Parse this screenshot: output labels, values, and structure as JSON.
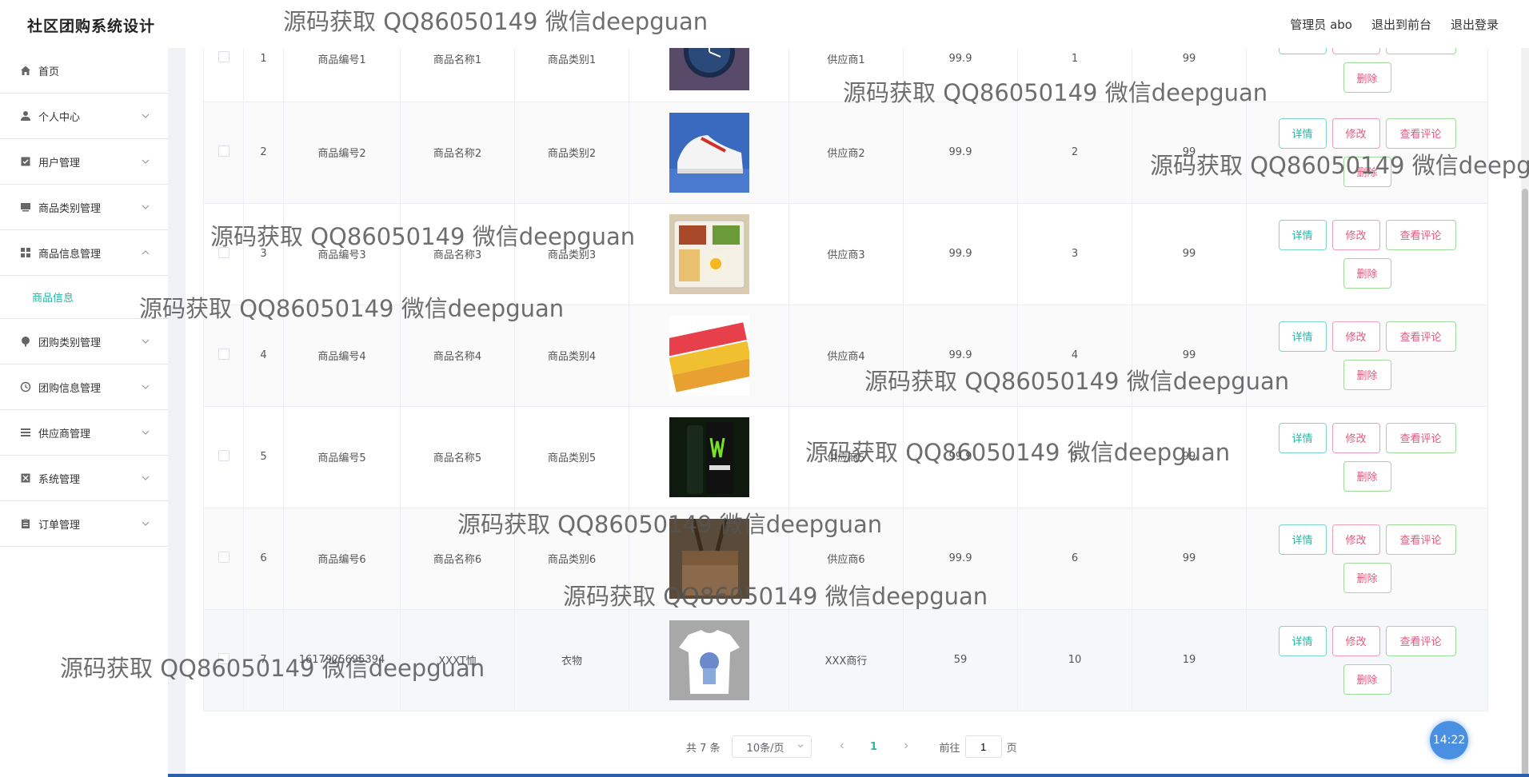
{
  "header": {
    "title": "社区团购系统设计",
    "admin_label": "管理员 abo",
    "back_to_front": "退出到前台",
    "logout": "退出登录"
  },
  "sidebar": {
    "items": [
      {
        "label": "首页",
        "icon": "home-icon"
      },
      {
        "label": "个人中心",
        "icon": "user-icon"
      },
      {
        "label": "用户管理",
        "icon": "checklist-icon"
      },
      {
        "label": "商品类别管理",
        "icon": "monitor-icon"
      },
      {
        "label": "商品信息管理",
        "icon": "grid-icon"
      },
      {
        "label": "团购类别管理",
        "icon": "paint-icon"
      },
      {
        "label": "团购信息管理",
        "icon": "clock-icon"
      },
      {
        "label": "供应商管理",
        "icon": "list-icon"
      },
      {
        "label": "系统管理",
        "icon": "settings-icon"
      },
      {
        "label": "订单管理",
        "icon": "clipboard-icon"
      }
    ],
    "active_sub": "商品信息"
  },
  "table": {
    "rows": [
      {
        "idx": "1",
        "code": "商品编号1",
        "name": "商品名称1",
        "category": "商品类别1",
        "image": "watch",
        "supplier": "供应商1",
        "price": "99.9",
        "col8": "1",
        "col9": "99"
      },
      {
        "idx": "2",
        "code": "商品编号2",
        "name": "商品名称2",
        "category": "商品类别2",
        "image": "sneaker",
        "supplier": "供应商2",
        "price": "99.9",
        "col8": "2",
        "col9": "99"
      },
      {
        "idx": "3",
        "code": "商品编号3",
        "name": "商品名称3",
        "category": "商品类别3",
        "image": "bento",
        "supplier": "供应商3",
        "price": "99.9",
        "col8": "3",
        "col9": "99"
      },
      {
        "idx": "4",
        "code": "商品编号4",
        "name": "商品名称4",
        "category": "商品类别4",
        "image": "snack",
        "supplier": "供应商4",
        "price": "99.9",
        "col8": "4",
        "col9": "99"
      },
      {
        "idx": "5",
        "code": "商品编号5",
        "name": "商品名称5",
        "category": "商品类别5",
        "image": "can",
        "supplier": "供应商5",
        "price": "99.9",
        "col8": "5",
        "col9": "99"
      },
      {
        "idx": "6",
        "code": "商品编号6",
        "name": "商品名称6",
        "category": "商品类别6",
        "image": "bag",
        "supplier": "供应商6",
        "price": "99.9",
        "col8": "6",
        "col9": "99"
      },
      {
        "idx": "7",
        "code": "1617925695394",
        "name": "XXXT恤",
        "category": "衣物",
        "image": "tshirt",
        "supplier": "XXX商行",
        "price": "59",
        "col8": "10",
        "col9": "19"
      }
    ],
    "buttons": {
      "detail": "详情",
      "edit": "修改",
      "review": "查看评论",
      "delete": "删除"
    }
  },
  "pagination": {
    "total": "共 7 条",
    "page_size": "10条/页",
    "current_page": "1",
    "goto_label": "前往",
    "goto_value": "1",
    "page_suffix": "页"
  },
  "clock": "14:22",
  "watermark": "源码获取 QQ86050149 微信deepguan"
}
